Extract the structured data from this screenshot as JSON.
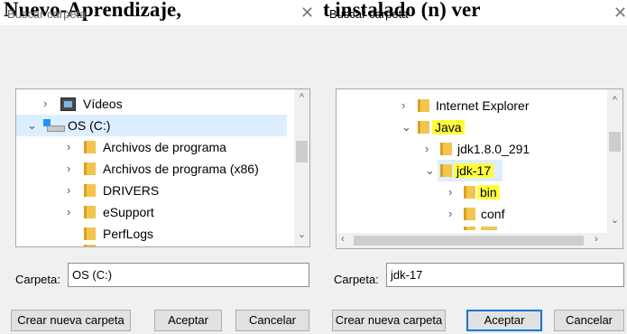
{
  "caption": {
    "left_text": "Nuevo-Aprendizaje, ",
    "right_text": "t instalado  (n) ver"
  },
  "left_dialog": {
    "title": "Buscar carpeta",
    "close_glyph": "✕",
    "tree": [
      {
        "label": "Vídeos",
        "expander": "›",
        "icon": "video-icon"
      },
      {
        "label": "OS (C:)",
        "expander": "⌄",
        "icon": "drive-icon",
        "selected": true
      },
      {
        "label": "Archivos de programa",
        "expander": "›",
        "icon": "folder-icon"
      },
      {
        "label": "Archivos de programa (x86)",
        "expander": "›",
        "icon": "folder-icon"
      },
      {
        "label": "DRIVERS",
        "expander": "›",
        "icon": "folder-icon"
      },
      {
        "label": "eSupport",
        "expander": "›",
        "icon": "folder-icon"
      },
      {
        "label": "PerfLogs",
        "expander": "",
        "icon": "folder-icon"
      }
    ],
    "scroll_up": "^",
    "scroll_down": "⌄",
    "folder_label": "Carpeta:",
    "folder_value": "OS (C:)",
    "buttons": {
      "new_folder": "Crear nueva carpeta",
      "accept": "Aceptar",
      "cancel": "Cancelar"
    }
  },
  "right_dialog": {
    "title": "Buscar carpeta",
    "close_glyph": "✕",
    "tree": [
      {
        "label": "Internet Explorer",
        "expander": "›",
        "icon": "folder-icon"
      },
      {
        "label": "Java",
        "expander": "⌄",
        "icon": "folder-icon",
        "highlight": true
      },
      {
        "label": "jdk1.8.0_291",
        "expander": "›",
        "icon": "folder-icon"
      },
      {
        "label": "jdk-17",
        "expander": "⌄",
        "icon": "folder-icon",
        "highlight": true,
        "selected": true
      },
      {
        "label": "bin",
        "expander": "›",
        "icon": "folder-icon",
        "highlight": true
      },
      {
        "label": "conf",
        "expander": "›",
        "icon": "folder-icon"
      }
    ],
    "scroll_up": "^",
    "scroll_down": "⌄",
    "scroll_left": "‹",
    "scroll_right": "›",
    "folder_label": "Carpeta:",
    "folder_value": "jdk-17",
    "buttons": {
      "new_folder": "Crear nueva carpeta",
      "accept": "Aceptar",
      "cancel": "Cancelar"
    }
  },
  "colors": {
    "highlight": "#ffff3d",
    "selection": "#ddeeff",
    "default_button_border": "#0078d7"
  }
}
